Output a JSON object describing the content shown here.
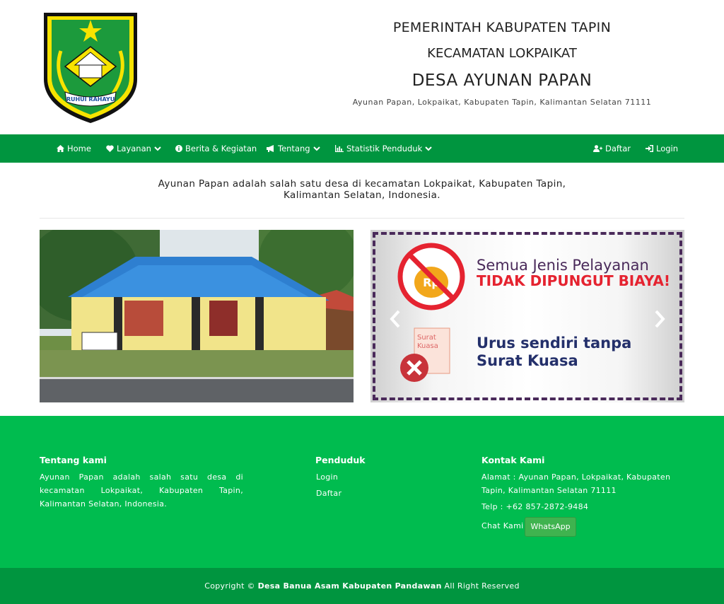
{
  "header": {
    "line1": "PEMERINTAH KABUPATEN TAPIN",
    "line2": "KECAMATAN LOKPAIKAT",
    "line3": "DESA AYUNAN PAPAN",
    "address": "Ayunan Papan, Lokpaikat, Kabupaten Tapin, Kalimantan Selatan 71111",
    "logo_text": "RUHUI RAHAYU"
  },
  "nav": {
    "home": "Home",
    "layanan": "Layanan",
    "berita": "Berita & Kegiatan",
    "tentang": "Tentang",
    "statistik": "Statistik Penduduk",
    "daftar": "Daftar",
    "login": "Login"
  },
  "intro": "Ayunan Papan adalah salah satu desa di kecamatan Lokpaikat, Kabupaten Tapin, Kalimantan Selatan, Indonesia.",
  "banner": {
    "line1": "Semua Jenis Pelayanan",
    "line2": "TIDAK DIPUNGUT BIAYA!",
    "line3a": "Urus sendiri tanpa",
    "line3b": "Surat Kuasa",
    "doc_label_a": "Surat",
    "doc_label_b": "Kuasa",
    "coin_label": "Rp"
  },
  "footer": {
    "about_title": "Tentang kami",
    "about_text": "Ayunan Papan adalah salah satu desa di kecamatan Lokpaikat, Kabupaten Tapin, Kalimantan Selatan, Indonesia.",
    "penduduk_title": "Penduduk",
    "login": "Login",
    "daftar": "Daftar",
    "kontak_title": "Kontak Kami",
    "alamat": "Alamat : Ayunan Papan, Lokpaikat, Kabupaten Tapin, Kalimantan Selatan 71111",
    "telp": "Telp : +62 857-2872-9484",
    "chat": "Chat Kami",
    "whatsapp": "WhatsApp"
  },
  "copyright": {
    "prefix": "Copyright ©",
    "name": "Desa Banua Asam Kabupaten Pandawan",
    "suffix": "All Right Reserved"
  },
  "colors": {
    "nav_green": "#00953f",
    "footer_green": "#00bc4f",
    "whatsapp": "#3fb34f"
  }
}
